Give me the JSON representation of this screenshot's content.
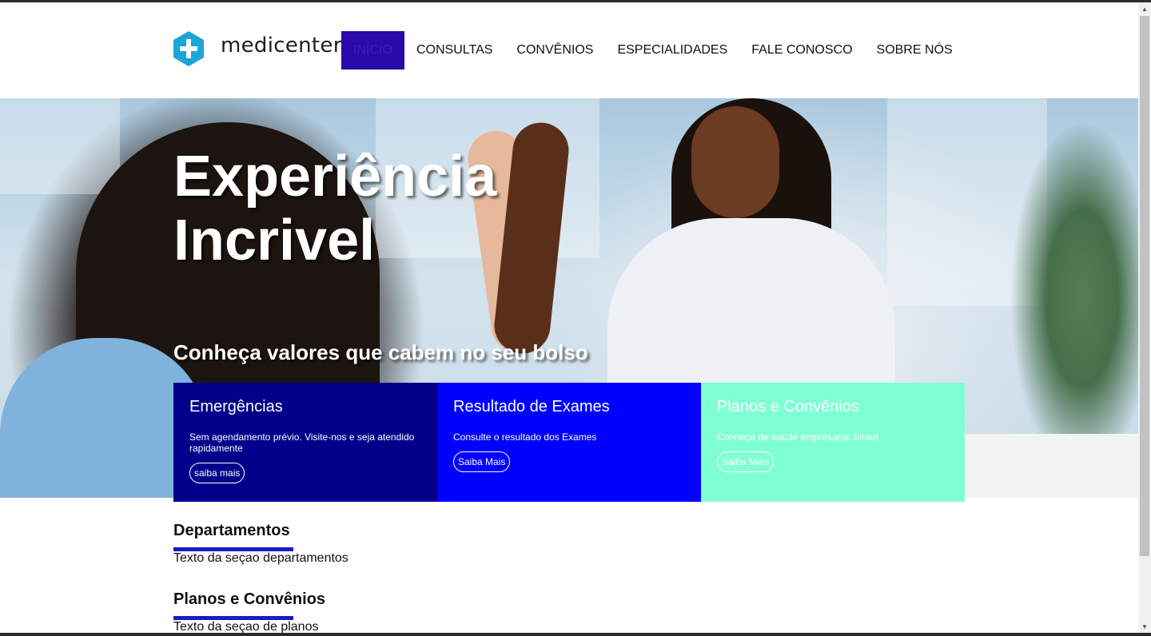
{
  "brand": {
    "name": "medicenter",
    "logo_color": "#1aa6d9"
  },
  "nav": {
    "items": [
      {
        "label": "INÍCIO",
        "active": true
      },
      {
        "label": "CONSULTAS",
        "active": false
      },
      {
        "label": "CONVÊNIOS",
        "active": false
      },
      {
        "label": "ESPECIALIDADES",
        "active": false
      },
      {
        "label": "FALE CONOSCO",
        "active": false
      },
      {
        "label": "SOBRE NÓS",
        "active": false
      }
    ],
    "active_bg": "#2a0aa8"
  },
  "hero": {
    "title_line1": "Experiência",
    "title_line2": "Incrivel",
    "subtitle": "Conheça valores que cabem no seu bolso"
  },
  "cards": [
    {
      "title": "Emergências",
      "text": "Sem agendamento prévio. Visite-nos e seja atendido rapidamente",
      "button": "saiba mais",
      "color": "#00008b"
    },
    {
      "title": "Resultado de Exames",
      "text": "Consulte o resultado dos Exames",
      "button": "Saiba Mais",
      "color": "#0000ff"
    },
    {
      "title": "Planos e Convênios",
      "text": "Conheça de saúde empresarial Smart",
      "button": "Saiba Mais",
      "color": "#7fffd4"
    }
  ],
  "sections": [
    {
      "title": "Departamentos",
      "text": "Texto da seçao departamentos"
    },
    {
      "title": "Planos e Convênios",
      "text": "Texto da seçao de planos"
    }
  ],
  "accent_bar_color": "#1a1ac8"
}
